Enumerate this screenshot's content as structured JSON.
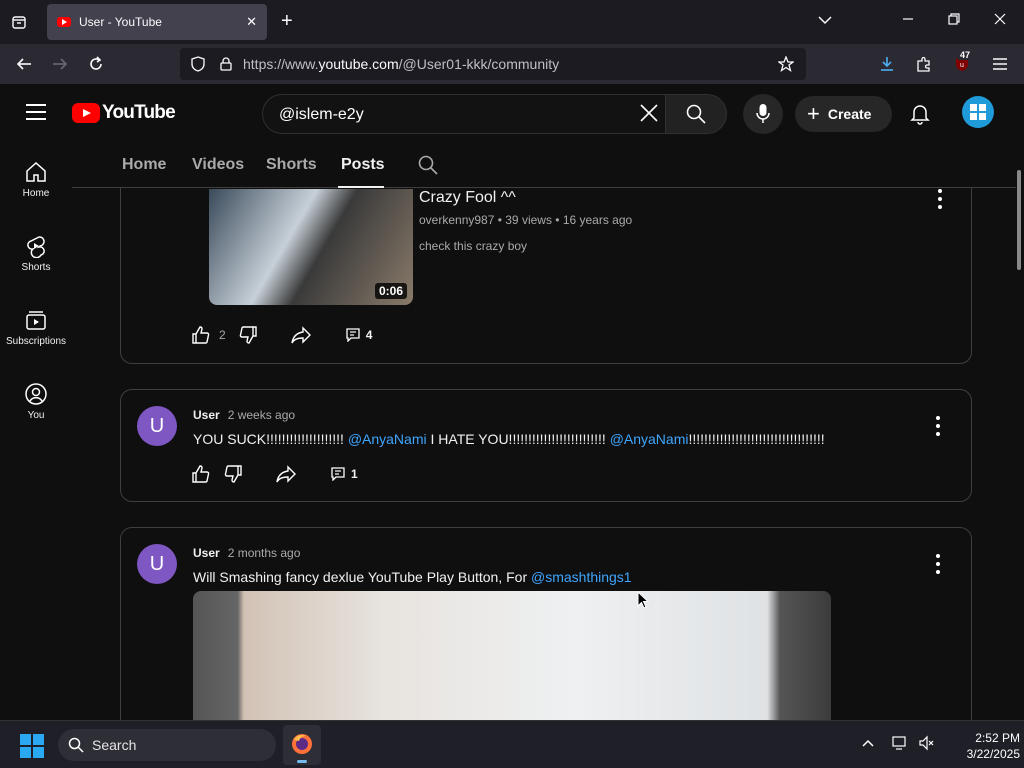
{
  "browser": {
    "tab_title": "User - YouTube",
    "url_prefix": "https://www.",
    "url_host": "youtube.com",
    "url_path": "/@User01-kkk/community",
    "extension_badge": "47"
  },
  "youtube": {
    "logo_text": "YouTube",
    "search_value": "@islem-e2y",
    "create_label": "Create",
    "guide": [
      {
        "label": "Home",
        "icon": "home-icon"
      },
      {
        "label": "Shorts",
        "icon": "shorts-icon"
      },
      {
        "label": "Subscriptions",
        "icon": "subscriptions-icon"
      },
      {
        "label": "You",
        "icon": "you-icon"
      }
    ],
    "channel_tabs": [
      "Home",
      "Videos",
      "Shorts",
      "Posts"
    ],
    "active_tab": "Posts"
  },
  "posts": [
    {
      "video": {
        "title": "Crazy Fool ^^",
        "meta": "overkenny987 • 39 views • 16 years ago",
        "description": "check this crazy boy",
        "duration": "0:06"
      },
      "likes": "2",
      "comments": "4"
    },
    {
      "avatar_letter": "U",
      "author": "User",
      "time": "2 weeks ago",
      "text_1": "YOU SUCK!!!!!!!!!!!!!!!!!!!! ",
      "mention_1": "@AnyaNami",
      "text_2": " I HATE YOU!!!!!!!!!!!!!!!!!!!!!!!!! ",
      "mention_2": "@AnyaNami",
      "text_3": "!!!!!!!!!!!!!!!!!!!!!!!!!!!!!!!!!!!",
      "comments": "1"
    },
    {
      "avatar_letter": "U",
      "author": "User",
      "time": "2 months ago",
      "text_1": "Will Smashing fancy dexlue YouTube Play Button, For ",
      "mention_1": "@smashthings1"
    }
  ],
  "taskbar": {
    "search_label": "Search",
    "time": "2:52 PM",
    "date": "3/22/2025"
  },
  "colors": {
    "accent_blue": "#3ea6ff",
    "avatar_purple": "#7e57c2",
    "youtube_red": "#ff0000"
  }
}
